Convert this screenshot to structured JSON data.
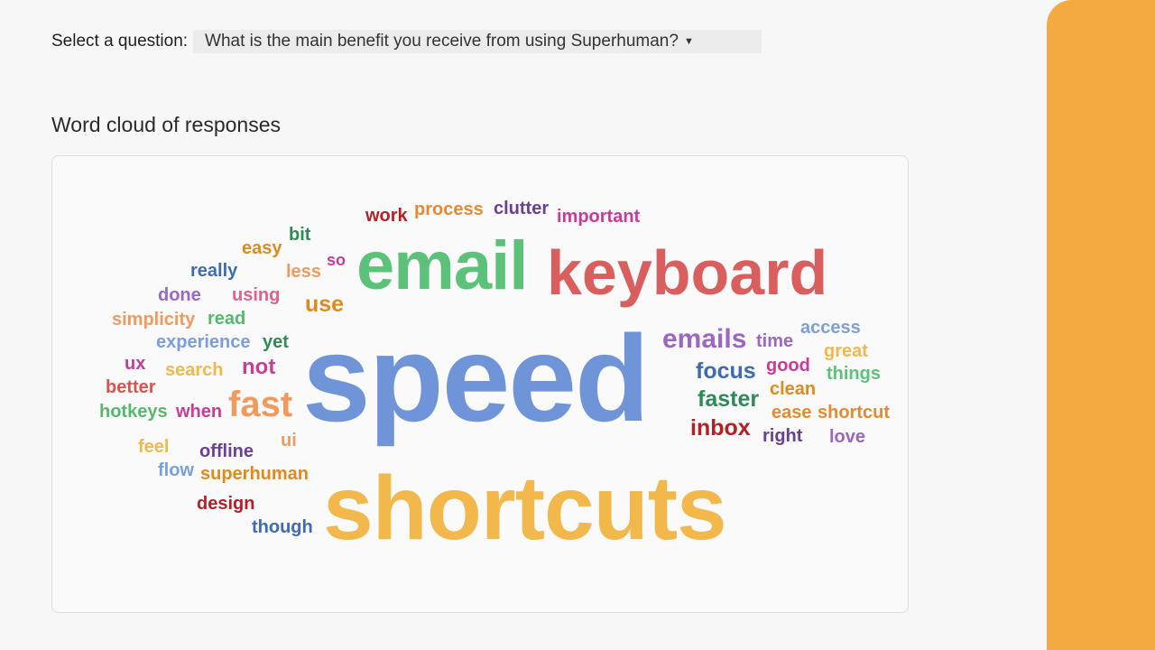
{
  "header": {
    "select_label": "Select a question:",
    "selected_question": "What is the main benefit you receive from using Superhuman?"
  },
  "section_title": "Word cloud of responses",
  "palette": {
    "accent_strip": "#f5a941",
    "blue": "#6f95d8",
    "yellow": "#f2b84b",
    "red": "#d95f5f",
    "green": "#5cc27a",
    "purple": "#9b67bf",
    "orange": "#e48a33",
    "dark_red": "#b51f25",
    "dark_green": "#2e8b57",
    "magenta": "#c63c99",
    "navy": "#3f6bb0",
    "dark_purple": "#6c3f91",
    "teal_green": "#57b86d"
  },
  "word_cloud": [
    {
      "text": "speed",
      "color": "#6f95d8"
    },
    {
      "text": "shortcuts",
      "color": "#f2b84b"
    },
    {
      "text": "keyboard",
      "color": "#d95f5f"
    },
    {
      "text": "email",
      "color": "#5cc27a"
    },
    {
      "text": "fast",
      "color": "#f09a5e"
    },
    {
      "text": "emails",
      "color": "#9b67bf"
    },
    {
      "text": "focus",
      "color": "#3f6bb0"
    },
    {
      "text": "faster",
      "color": "#2e8b57"
    },
    {
      "text": "inbox",
      "color": "#b51f25"
    },
    {
      "text": "use",
      "color": "#e08a1e"
    },
    {
      "text": "work",
      "color": "#b51f25"
    },
    {
      "text": "process",
      "color": "#e48a33"
    },
    {
      "text": "clutter",
      "color": "#6c3f91"
    },
    {
      "text": "important",
      "color": "#c63c99"
    },
    {
      "text": "bit",
      "color": "#2e8b57"
    },
    {
      "text": "easy",
      "color": "#e08a1e"
    },
    {
      "text": "so",
      "color": "#c63c99"
    },
    {
      "text": "really",
      "color": "#3f6bb0"
    },
    {
      "text": "less",
      "color": "#f09a5e"
    },
    {
      "text": "done",
      "color": "#9b67bf"
    },
    {
      "text": "using",
      "color": "#e0628a"
    },
    {
      "text": "simplicity",
      "color": "#f09a5e"
    },
    {
      "text": "read",
      "color": "#57b86d"
    },
    {
      "text": "experience",
      "color": "#7a9ee0"
    },
    {
      "text": "yet",
      "color": "#2e8b57"
    },
    {
      "text": "ux",
      "color": "#c63c99"
    },
    {
      "text": "search",
      "color": "#f2b84b"
    },
    {
      "text": "not",
      "color": "#c63c99"
    },
    {
      "text": "better",
      "color": "#d9534f"
    },
    {
      "text": "hotkeys",
      "color": "#57b86d"
    },
    {
      "text": "when",
      "color": "#c63c99"
    },
    {
      "text": "feel",
      "color": "#f2b84b"
    },
    {
      "text": "ui",
      "color": "#f09a5e"
    },
    {
      "text": "offline",
      "color": "#6c3f91"
    },
    {
      "text": "flow",
      "color": "#7a9ee0"
    },
    {
      "text": "superhuman",
      "color": "#e08a1e"
    },
    {
      "text": "design",
      "color": "#b51f25"
    },
    {
      "text": "though",
      "color": "#3f6bb0"
    },
    {
      "text": "time",
      "color": "#9b67bf"
    },
    {
      "text": "access",
      "color": "#7a9ee0"
    },
    {
      "text": "great",
      "color": "#f2b84b"
    },
    {
      "text": "good",
      "color": "#c63c99"
    },
    {
      "text": "things",
      "color": "#5cc27a"
    },
    {
      "text": "clean",
      "color": "#e08a1e"
    },
    {
      "text": "ease",
      "color": "#e48a33"
    },
    {
      "text": "shortcut",
      "color": "#e48a33"
    },
    {
      "text": "right",
      "color": "#6c3f91"
    },
    {
      "text": "love",
      "color": "#9b67bf"
    }
  ]
}
